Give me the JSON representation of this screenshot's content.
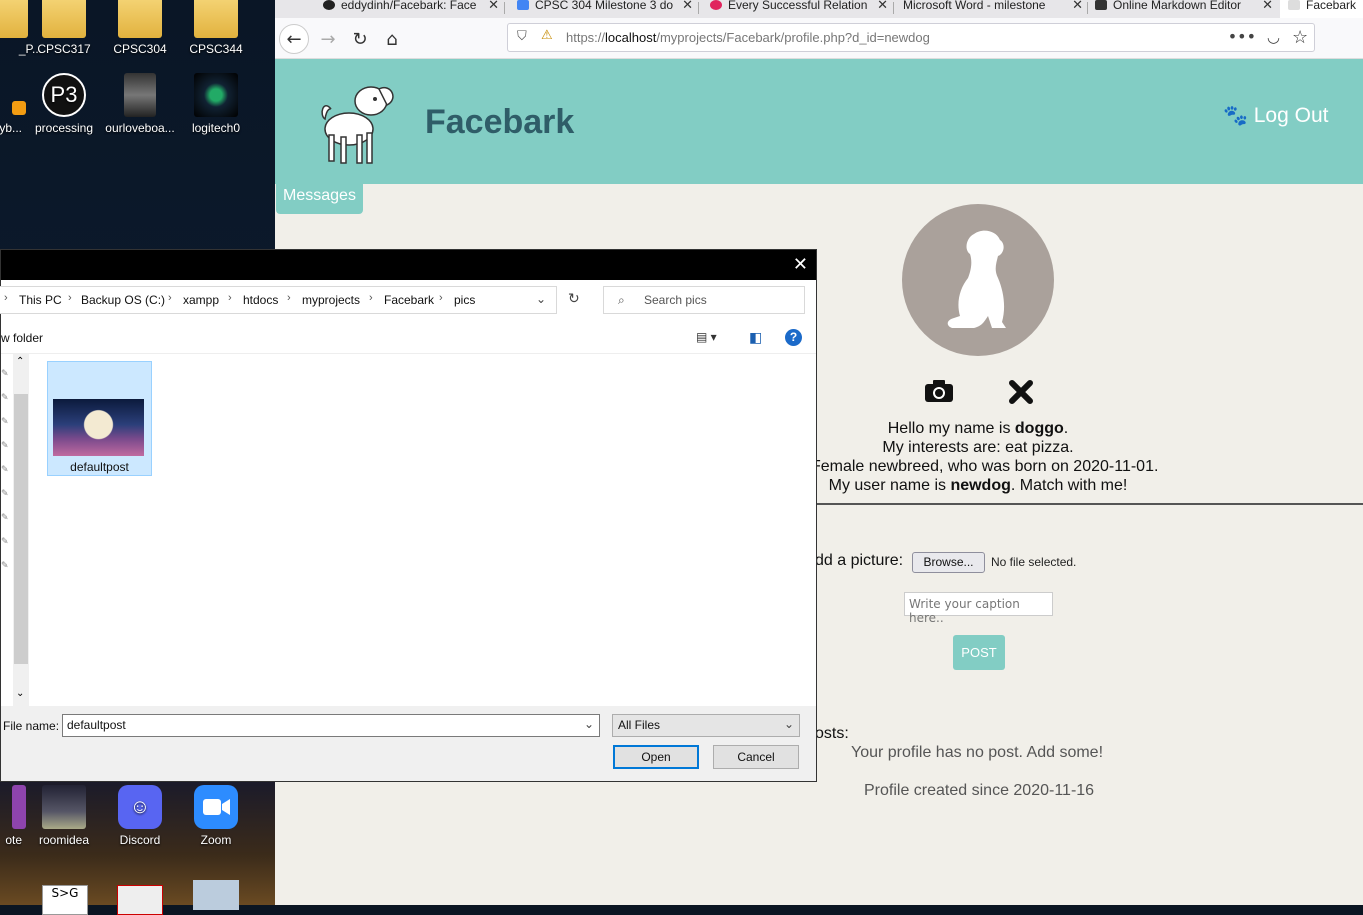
{
  "desktop": {
    "icons_top": [
      {
        "label": "_P..."
      },
      {
        "label": "CPSC317"
      },
      {
        "label": "CPSC304"
      },
      {
        "label": "CPSC344"
      }
    ],
    "icons_mid": [
      {
        "label": "yb..."
      },
      {
        "label": "processing"
      },
      {
        "label": "ourloveboa..."
      },
      {
        "label": "logitech0"
      }
    ],
    "icons_bottom": [
      {
        "label": "ote"
      },
      {
        "label": "roomidea"
      },
      {
        "label": "Discord"
      },
      {
        "label": "Zoom"
      }
    ]
  },
  "browser": {
    "tabs": [
      {
        "label": "eddydinh/Facebark: Face"
      },
      {
        "label": "CPSC 304 Milestone 3 do"
      },
      {
        "label": "Every Successful Relation"
      },
      {
        "label": "Microsoft Word - milestone"
      },
      {
        "label": "Online Markdown Editor"
      },
      {
        "label": "Facebark"
      }
    ],
    "url": {
      "prefix": "https://",
      "host": "localhost",
      "path": "/myprojects/Facebark/profile.php?d_id=newdog"
    }
  },
  "page": {
    "site_title": "Facebark",
    "logout_label": "Log Out",
    "messages_label": "Messages",
    "bio": {
      "line1_pre": "Hello my name is ",
      "name": "doggo",
      "line1_post": ".",
      "line2": "My interests are: eat pizza.",
      "line3": "a Female newbreed, who was born on 2020-11-01.",
      "line4_pre": "My user name is ",
      "username": "newdog",
      "line4_post": ". Match with me!"
    },
    "add_picture_label": "dd a picture:",
    "browse_label": "Browse...",
    "no_file_label": "No file selected.",
    "caption_placeholder": "Write your caption here..",
    "post_label": "POST",
    "posts_label": "osts:",
    "no_posts_text": "Your profile has no post. Add some!",
    "profile_created": "Profile created since 2020-11-16"
  },
  "dialog": {
    "breadcrumb": [
      "This PC",
      "Backup OS (C:)",
      "xampp",
      "htdocs",
      "myprojects",
      "Facebark",
      "pics"
    ],
    "search_placeholder": "Search pics",
    "new_folder_label": "w folder",
    "file_item_label": "defaultpost",
    "file_name_label": "File name:",
    "file_name_value": "defaultpost",
    "file_type_value": "All Files",
    "open_label": "Open",
    "cancel_label": "Cancel"
  }
}
